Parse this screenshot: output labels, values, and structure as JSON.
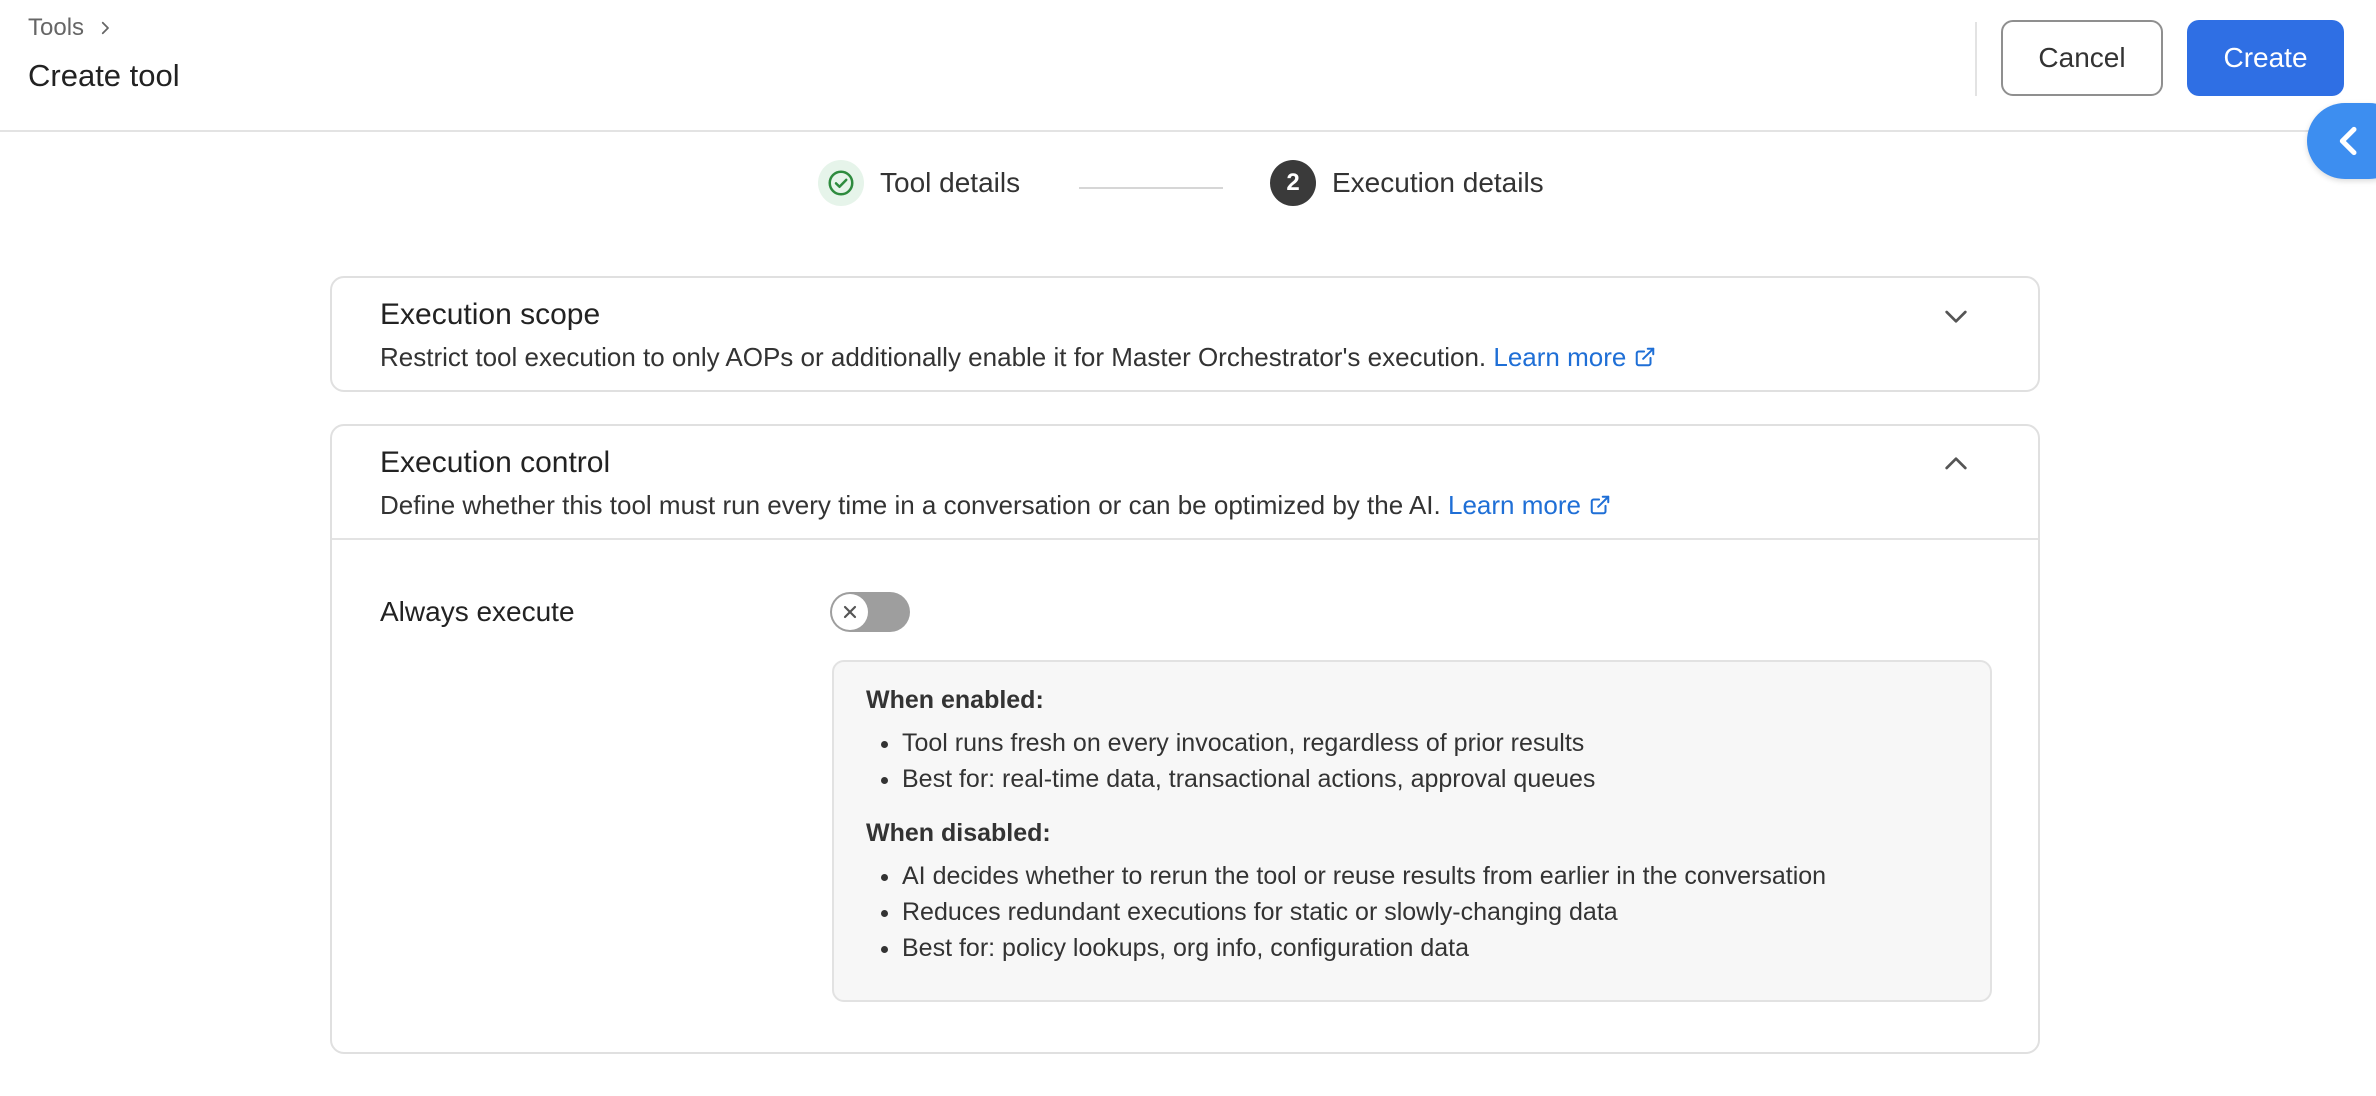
{
  "header": {
    "breadcrumb": "Tools",
    "title": "Create tool",
    "cancel_label": "Cancel",
    "create_label": "Create"
  },
  "stepper": {
    "steps": [
      {
        "label": "Tool details",
        "status": "completed"
      },
      {
        "label": "Execution details",
        "number": "2",
        "status": "active"
      }
    ]
  },
  "sections": {
    "scope": {
      "title": "Execution scope",
      "description": "Restrict tool execution to only AOPs or additionally enable it for Master Orchestrator's execution.",
      "learn_more": "Learn more",
      "expanded": false
    },
    "control": {
      "title": "Execution control",
      "description": "Define whether this tool must run every time in a conversation or can be optimized by the AI.",
      "learn_more": "Learn more",
      "expanded": true,
      "always_execute": {
        "label": "Always execute",
        "enabled": false
      },
      "info": {
        "enabled_heading": "When enabled:",
        "enabled_items": [
          "Tool runs fresh on every invocation, regardless of prior results",
          "Best for: real-time data, transactional actions, approval queues"
        ],
        "disabled_heading": "When disabled:",
        "disabled_items": [
          "AI decides whether to rerun the tool or reuse results from earlier in the conversation",
          "Reduces redundant executions for static or slowly-changing data",
          "Best for: policy lookups, org info, configuration data"
        ]
      }
    }
  },
  "colors": {
    "primary": "#2f6fe4",
    "link": "#1f6fd6",
    "success": "#2e8b3e",
    "side_tab": "#3d8ef0"
  }
}
